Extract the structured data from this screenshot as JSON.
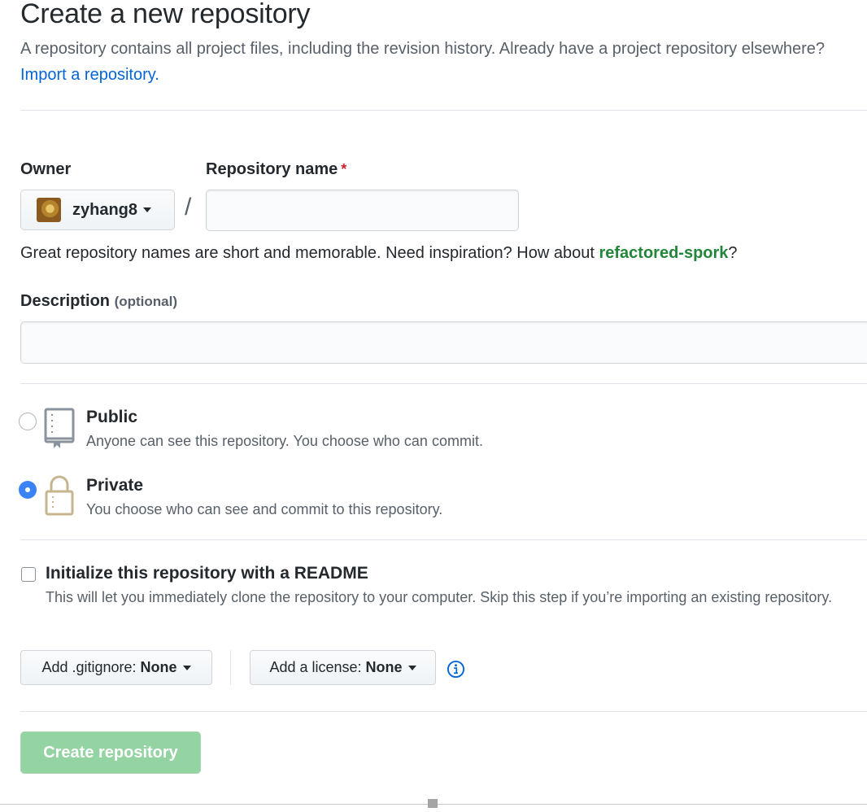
{
  "header": {
    "title": "Create a new repository",
    "subtitle": "A repository contains all project files, including the revision history. Already have a project repository elsewhere?",
    "import_link": "Import a repository."
  },
  "owner": {
    "label": "Owner",
    "name": "zyhang8"
  },
  "repo_name": {
    "label": "Repository name",
    "required_mark": "*",
    "value": "",
    "separator": "/"
  },
  "name_hint": {
    "text": "Great repository names are short and memorable. Need inspiration? How about",
    "suggestion": "refactored-spork",
    "end": "?"
  },
  "description": {
    "label": "Description",
    "optional": "(optional)",
    "value": ""
  },
  "visibility": {
    "public": {
      "title": "Public",
      "desc": "Anyone can see this repository. You choose who can commit.",
      "selected": false
    },
    "private": {
      "title": "Private",
      "desc": "You choose who can see and commit to this repository.",
      "selected": true
    }
  },
  "readme": {
    "title": "Initialize this repository with a README",
    "desc": "This will let you immediately clone the repository to your computer. Skip this step if you’re importing an existing repository.",
    "checked": false
  },
  "gitignore": {
    "prefix": "Add .gitignore:",
    "value": "None"
  },
  "license": {
    "prefix": "Add a license:",
    "value": "None"
  },
  "create_button": "Create repository",
  "colors": {
    "link": "#0366d6",
    "suggestion": "#22863a",
    "required": "#cb2431",
    "create_button_bg": "#94d3a2",
    "radio_checked": "#3b82f6"
  }
}
